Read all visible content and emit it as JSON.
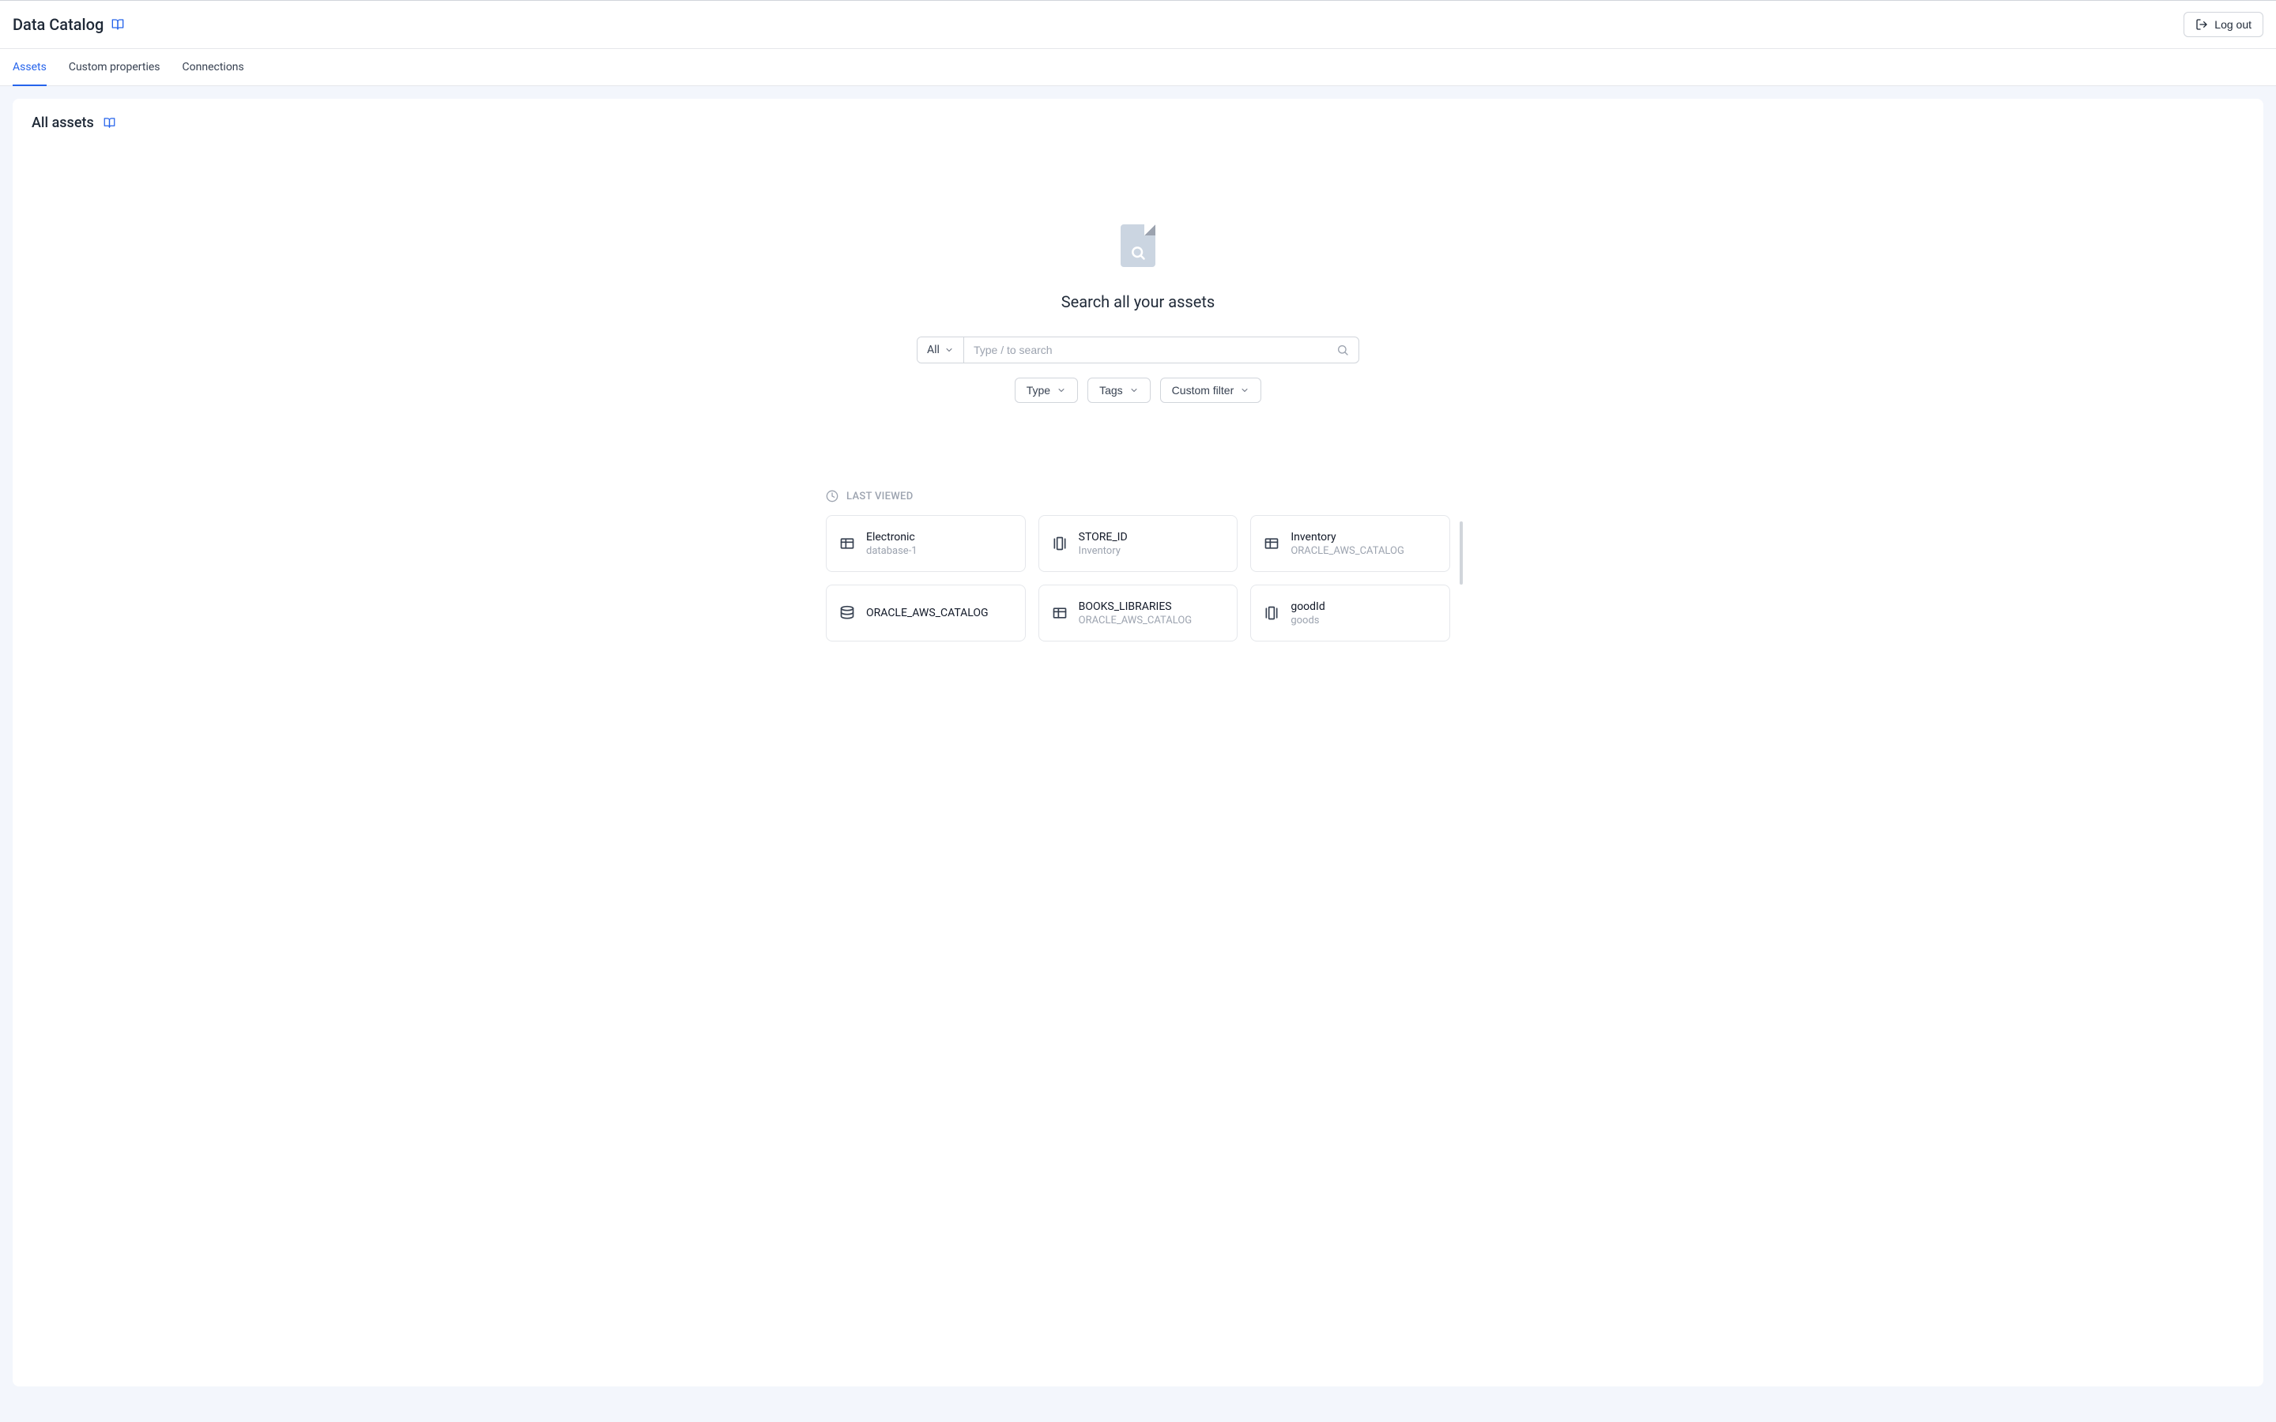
{
  "header": {
    "title": "Data Catalog",
    "logout_label": "Log out"
  },
  "tabs": [
    {
      "label": "Assets",
      "active": true
    },
    {
      "label": "Custom properties",
      "active": false
    },
    {
      "label": "Connections",
      "active": false
    }
  ],
  "panel": {
    "title": "All assets"
  },
  "search": {
    "heading": "Search all your assets",
    "scope_label": "All",
    "placeholder": "Type / to search"
  },
  "filters": [
    {
      "label": "Type"
    },
    {
      "label": "Tags"
    },
    {
      "label": "Custom filter"
    }
  ],
  "last_viewed": {
    "heading": "LAST VIEWED",
    "items": [
      {
        "title": "Electronic",
        "sub": "database-1",
        "icon": "table"
      },
      {
        "title": "STORE_ID",
        "sub": "Inventory",
        "icon": "column"
      },
      {
        "title": "Inventory",
        "sub": "ORACLE_AWS_CATALOG",
        "icon": "table"
      },
      {
        "title": "ORACLE_AWS_CATALOG",
        "sub": "",
        "icon": "database"
      },
      {
        "title": "BOOKS_LIBRARIES",
        "sub": "ORACLE_AWS_CATALOG",
        "icon": "table"
      },
      {
        "title": "goodId",
        "sub": "goods",
        "icon": "column"
      }
    ]
  }
}
